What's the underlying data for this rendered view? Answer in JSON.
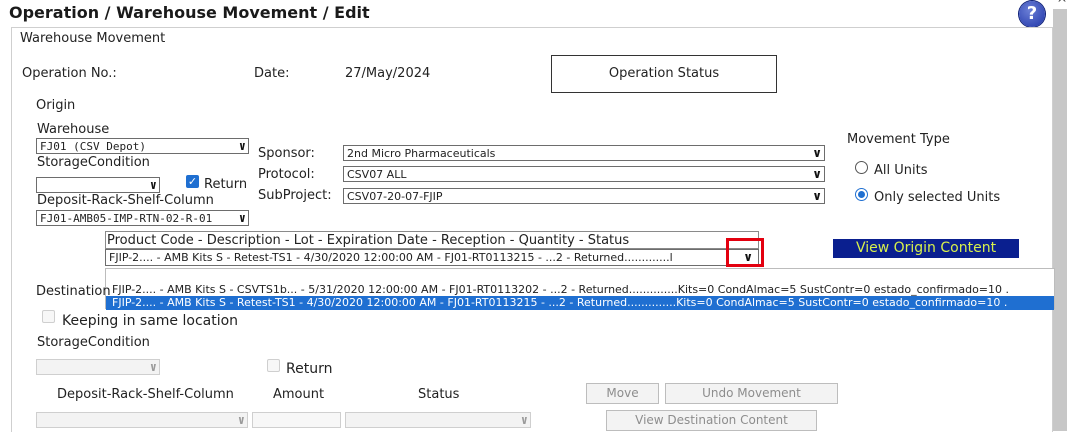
{
  "header": {
    "title": "Operation / Warehouse Movement / Edit",
    "help_icon": "?"
  },
  "panel": {
    "legend": "Warehouse Movement"
  },
  "operation": {
    "no_label": "Operation No.:",
    "date_label": "Date:",
    "date_value": "27/May/2024",
    "status_button": "Operation Status"
  },
  "origin": {
    "title": "Origin",
    "warehouse_label": "Warehouse",
    "warehouse_value": "FJ01 (CSV Depot)",
    "storage_label": "StorageCondition",
    "storage_value": "",
    "return_label": "Return",
    "return_checked": true,
    "deposit_label": "Deposit-Rack-Shelf-Column",
    "deposit_value": "FJ01-AMB05-IMP-RTN-02-R-01"
  },
  "sponsor": {
    "sponsor_label": "Sponsor:",
    "sponsor_value": "2nd Micro Pharmaceuticals",
    "protocol_label": "Protocol:",
    "protocol_value": "CSV07 ALL",
    "subproject_label": "SubProject:",
    "subproject_value": "CSV07-20-07-FJIP"
  },
  "movement_type": {
    "label": "Movement Type",
    "options": [
      "All Units",
      "Only selected Units"
    ],
    "selected": "Only selected Units"
  },
  "product": {
    "header": "Product Code - Description - Lot - Expiration Date - Reception - Quantity - Status",
    "selected_value": "FJIP-2.... - AMB Kits S - Retest-TS1 - 4/30/2020 12:00:00 AM - FJ01-RT0113215 - ...2 - Returned.............l",
    "options": [
      "FJIP-2.... - AMB Kits S - CSVTS1b... - 5/31/2020 12:00:00 AM - FJ01-RT0113202 - ...2 - Returned..............Kits=0 CondAlmac=5 SustContr=0 estado_confirmado=10 .",
      "FJIP-2.... - AMB Kits S - Retest-TS1 - 4/30/2020 12:00:00 AM - FJ01-RT0113215 - ...2 - Returned..............Kits=0 CondAlmac=5 SustContr=0 estado_confirmado=10 ."
    ],
    "view_origin": "View Origin Content"
  },
  "destination": {
    "title": "Destination",
    "keeping_label": "Keeping in same location",
    "storage_label": "StorageCondition",
    "return_label": "Return",
    "deposit_label": "Deposit-Rack-Shelf-Column",
    "amount_label": "Amount",
    "status_label": "Status",
    "move_button": "Move",
    "undo_button": "Undo Movement",
    "view_dest_button": "View Destination Content"
  },
  "colors": {
    "accent": "#1f6fd1",
    "view_origin_bg": "#0a1f8f",
    "view_origin_text": "#d7f04c",
    "highlight_border": "#e3000f"
  }
}
